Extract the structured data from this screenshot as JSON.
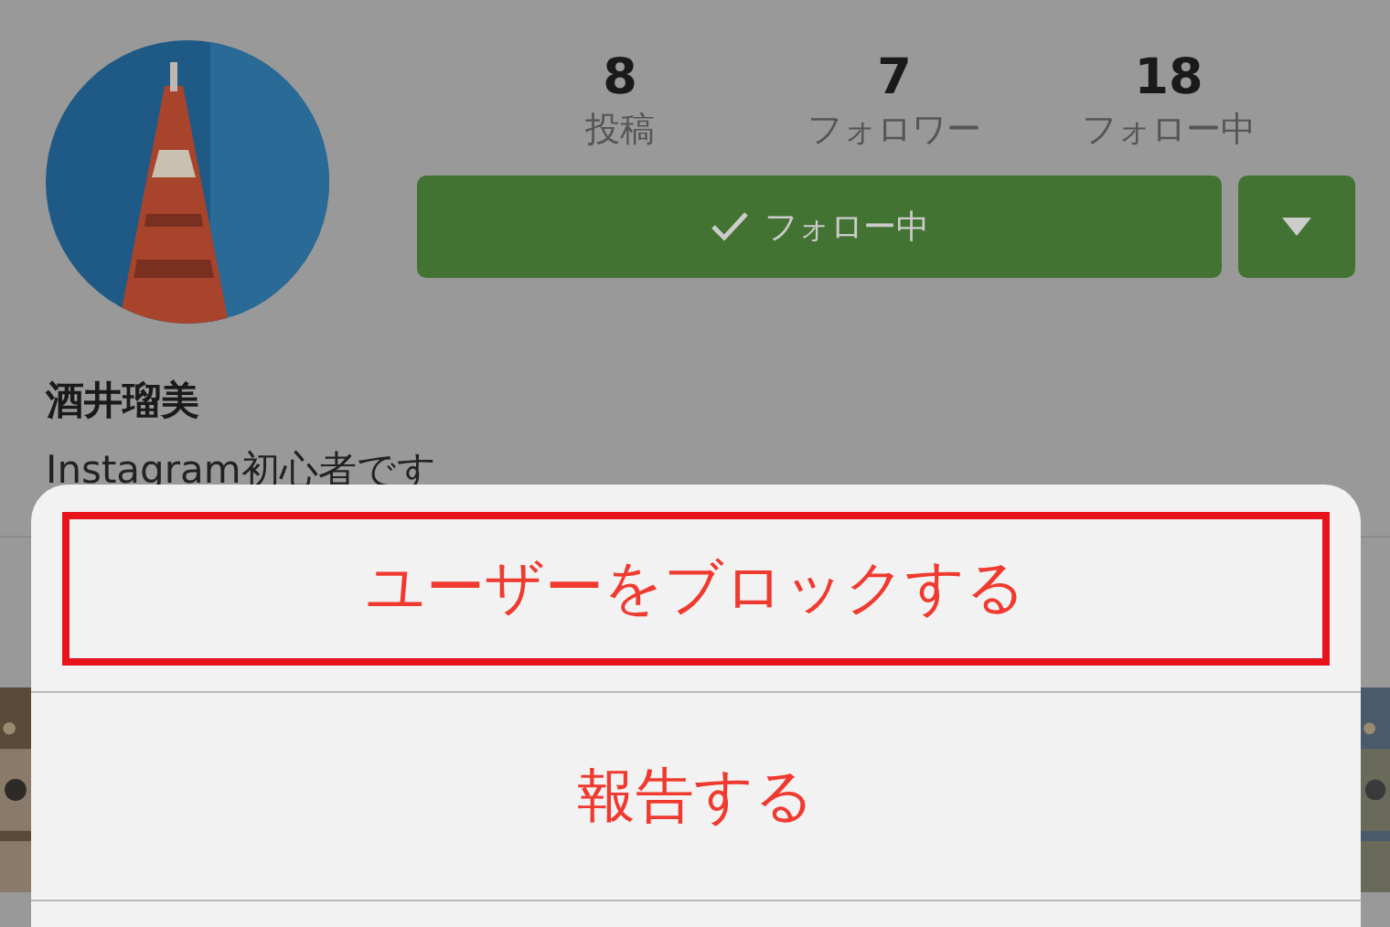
{
  "profile": {
    "stats": [
      {
        "value": "8",
        "label": "投稿"
      },
      {
        "value": "7",
        "label": "フォロワー"
      },
      {
        "value": "18",
        "label": "フォロー中"
      }
    ],
    "follow_button": {
      "label": "フォロー中",
      "following": true
    },
    "name": "酒井瑠美",
    "bio": "Instagram初心者です"
  },
  "action_sheet": {
    "options": [
      {
        "label": "ユーザーをブロックする",
        "highlighted": true
      },
      {
        "label": "報告する",
        "highlighted": false
      }
    ]
  }
}
